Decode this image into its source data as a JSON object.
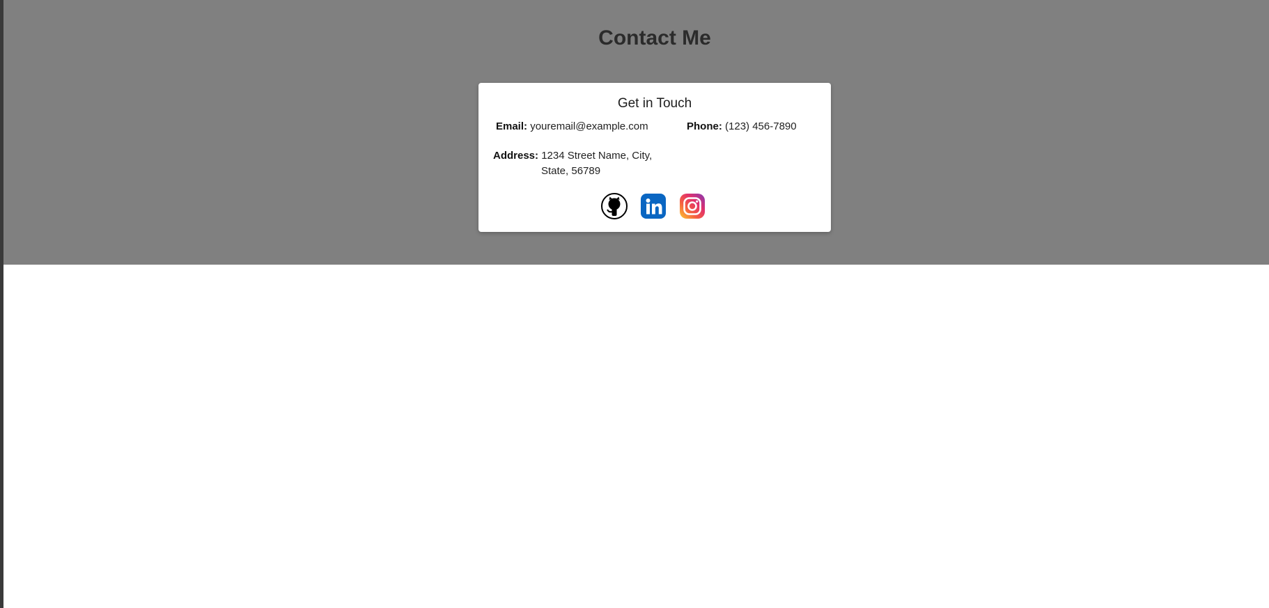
{
  "page": {
    "title": "Contact Me"
  },
  "card": {
    "title": "Get in Touch",
    "email": {
      "label": "Email:",
      "value": "youremail@example.com"
    },
    "phone": {
      "label": "Phone:",
      "value": "(123) 456-7890"
    },
    "address": {
      "label": "Address:",
      "line1": "1234 Street Name, City,",
      "line2": "State, 56789"
    },
    "socials": [
      {
        "name": "github-icon"
      },
      {
        "name": "linkedin-icon"
      },
      {
        "name": "instagram-icon"
      }
    ]
  },
  "colors": {
    "hero_background": "#808080",
    "linkedin": "#0a66c2",
    "card_background": "#ffffff"
  }
}
